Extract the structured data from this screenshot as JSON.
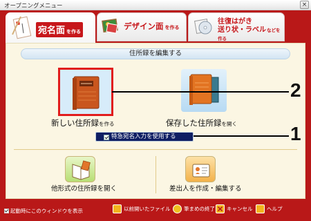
{
  "window": {
    "title": "オープニングメニュー",
    "close": "×"
  },
  "tabs": [
    {
      "label_main": "宛名面",
      "label_sub": "を作る",
      "active": true,
      "icon": "letter-icon"
    },
    {
      "label_main": "デザイン面",
      "label_sub": "を作る",
      "active": false,
      "icon": "photo-icon"
    },
    {
      "label_main_1": "往復はがき",
      "label_main_2": "送り状・ラベル",
      "label_sub": "などを作る",
      "active": false,
      "icon": "disc-icon"
    }
  ],
  "section": {
    "title": "住所録を編集する"
  },
  "actions": {
    "new_address_book": {
      "label": "新しい住所録",
      "suffix": "を作る",
      "icon": "address-book-icon"
    },
    "open_saved_address_book": {
      "label": "保存した住所録",
      "suffix": "を開く",
      "icon": "address-book-icon"
    },
    "express_address_checkbox": {
      "label": "特急宛名入力を使用する",
      "checked": true
    },
    "open_other_format": {
      "label": "他形式の住所録を開く",
      "icon": "open-book-icon"
    },
    "sender_edit": {
      "label": "差出人を作成・編集する",
      "icon": "sender-card-icon"
    }
  },
  "footer": {
    "startup_checkbox": {
      "label": "起動時にこのウィンドウを表示",
      "checked": true
    },
    "buttons": [
      {
        "label": "以前開いたファイル",
        "icon": "recent-file-icon"
      },
      {
        "label": "筆まめの終了",
        "icon": "exit-icon"
      },
      {
        "label": "キャンセル",
        "icon": "cancel-icon"
      },
      {
        "label": "ヘルプ",
        "icon": "help-icon"
      }
    ]
  },
  "callouts": [
    {
      "number": "2"
    },
    {
      "number": "1"
    }
  ],
  "colors": {
    "frame": "#b91818",
    "panel": "#fbf6e3",
    "checkbar": "#0f1e63",
    "highlight": "#e11c1c"
  }
}
